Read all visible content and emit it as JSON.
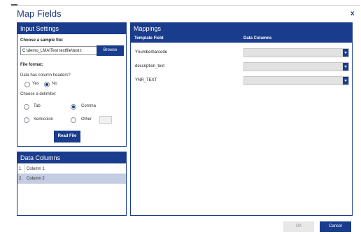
{
  "dialog": {
    "title": "Map Fields",
    "close_label": "x"
  },
  "input_settings": {
    "title": "Input Settings",
    "sample_file_label": "Choose a sample file:",
    "sample_file_value": "C:\\demo_LMA\\Test textfile\\test.t",
    "browse_label": "Browse",
    "file_format_label": "File format:",
    "headers_question": "Data has column headers?",
    "headers_options": [
      {
        "label": "Yes",
        "selected": false
      },
      {
        "label": "No",
        "selected": true
      }
    ],
    "delimiter_label": "Choose a delimiter:",
    "delimiter_options": [
      {
        "label": "Tab",
        "selected": false
      },
      {
        "label": "Comma",
        "selected": true
      },
      {
        "label": "Semicolon",
        "selected": false
      },
      {
        "label": "Other",
        "selected": false
      }
    ],
    "read_file_label": "Read File"
  },
  "data_columns": {
    "title": "Data Columns",
    "rows": [
      {
        "num": "1.",
        "name": "Column 1",
        "selected": false
      },
      {
        "num": "2.",
        "name": "Column 2",
        "selected": true
      }
    ]
  },
  "mappings": {
    "title": "Mappings",
    "headers": {
      "template_field": "Template Field",
      "data_columns": "Data Columns"
    },
    "rows": [
      {
        "field": "Ynumberbarcode",
        "value": ""
      },
      {
        "field": "description_text",
        "value": ""
      },
      {
        "field": "YNR_TEXT",
        "value": ""
      }
    ]
  },
  "footer": {
    "ok_label": "OK",
    "cancel_label": "Cancel"
  },
  "colors": {
    "accent": "#1a3c8c",
    "selected_row": "#c5cde3",
    "title_text": "#1f3a7a"
  }
}
